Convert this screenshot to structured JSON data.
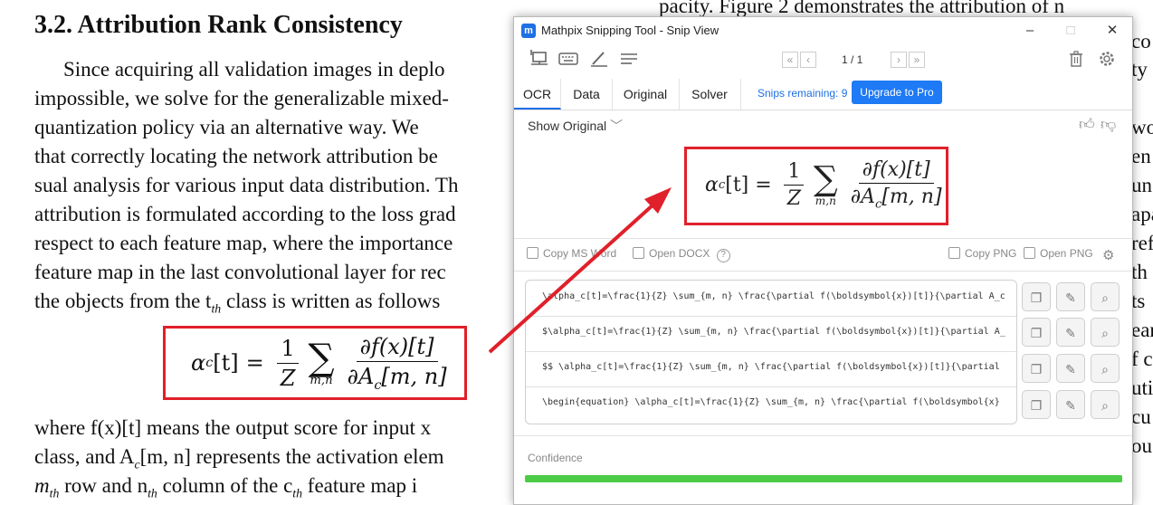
{
  "paper": {
    "heading": "3.2. Attribution Rank Consistency",
    "lines": [
      "Since acquiring all validation images in deplo",
      "impossible, we solve for the generalizable mixed-",
      "quantization policy via an alternative way.  We",
      "that correctly locating the network attribution be",
      "sual analysis for various input data distribution. Th",
      "attribution is formulated according to the loss grad",
      "respect to each feature map, where the importance",
      "feature map in the last convolutional layer for rec",
      "the objects from the t",
      "class is written as follows"
    ],
    "t_sub": "th",
    "after_lines": [
      "where f(x)[t] means the output score for input x",
      "class, and A",
      "[m, n] represents the activation elem",
      "row and n",
      "column of the c",
      "feature map i"
    ],
    "after_subs": [
      "c",
      "m",
      "th",
      "th",
      "th"
    ],
    "top_fragment": "pacity.  Figure 2 demonstrates the attribution of n",
    "right_fragments": [
      "co",
      "ty",
      "wo",
      "en",
      "un",
      "apa",
      "ref",
      "th",
      "ts",
      "ear",
      "f c",
      "uti",
      "cu",
      "ou"
    ],
    "equation": {
      "lhs": "α",
      "lhs_sub": "c",
      "lhs_arg": "[t]",
      "eq": "=",
      "frac1_num": "1",
      "frac1_den": "Z",
      "sum_sub": "m,n",
      "num": "∂f(x)[t]",
      "den_d": "∂A",
      "den_sub": "c",
      "den_arg": "[m, n]"
    }
  },
  "window": {
    "title": "Mathpix Snipping Tool - Snip View",
    "app_icon": "m",
    "controls": {
      "minimize": "–",
      "maximize": "□",
      "close": "✕"
    },
    "toolbar": {
      "icons": [
        "screen-snip-icon",
        "keyboard-icon",
        "pen-icon",
        "menu-icon"
      ],
      "page": "1 / 1",
      "right_icons": [
        "trash-icon",
        "gear-icon"
      ]
    },
    "tabs": [
      "OCR",
      "Data",
      "Original",
      "Solver"
    ],
    "active_tab": "OCR",
    "snips_remaining": "Snips remaining: 9",
    "upgrade_label": "Upgrade to Pro",
    "show_original": "Show Original",
    "actions": {
      "copy_ms_word": "Copy MS Word",
      "open_docx": "Open DOCX",
      "copy_png": "Copy PNG",
      "open_png": "Open PNG"
    },
    "code_rows": [
      "\\alpha_c[t]=\\frac{1}{Z} \\sum_{m, n} \\frac{\\partial f(\\boldsymbol{x})[t]}{\\partial A_c",
      "$\\alpha_c[t]=\\frac{1}{Z} \\sum_{m, n} \\frac{\\partial f(\\boldsymbol{x})[t]}{\\partial A_",
      "$$  \\alpha_c[t]=\\frac{1}{Z} \\sum_{m, n} \\frac{\\partial f(\\boldsymbol{x})[t]}{\\partial",
      "\\begin{equation}  \\alpha_c[t]=\\frac{1}{Z} \\sum_{m, n} \\frac{\\partial f(\\boldsymbol{x}"
    ],
    "confidence_label": "Confidence",
    "confidence": 1.0,
    "colors": {
      "accent": "#1e7af5",
      "highlight": "#e0202a",
      "confidence": "#4ccb46"
    }
  }
}
